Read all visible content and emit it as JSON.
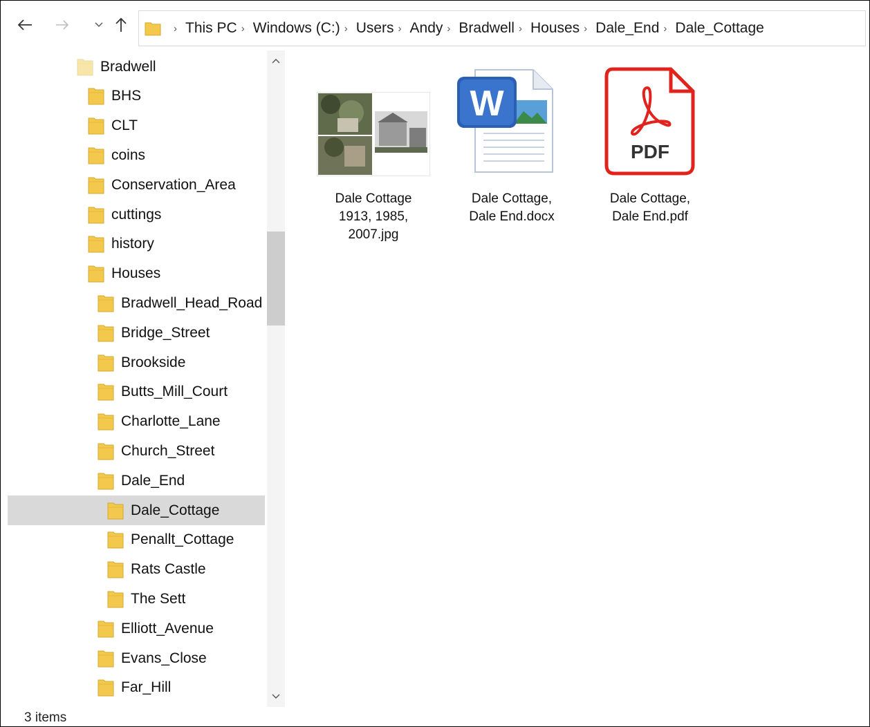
{
  "breadcrumb": [
    "This PC",
    "Windows (C:)",
    "Users",
    "Andy",
    "Bradwell",
    "Houses",
    "Dale_End",
    "Dale_Cottage"
  ],
  "icons": {
    "back": "arrow-left-icon",
    "forward": "arrow-right-icon",
    "recent": "chevron-down-icon",
    "up": "arrow-up-icon",
    "folder": "folder-icon"
  },
  "colors": {
    "folder": "#f2c94c",
    "folder_light": "#f8e6a8",
    "selected_bg": "#d9d9d9",
    "pdf_red": "#e1231e",
    "word_blue": "#2b5fb4"
  },
  "tree": [
    {
      "label": "Bradwell",
      "level": 0
    },
    {
      "label": "BHS",
      "level": 1
    },
    {
      "label": "CLT",
      "level": 1
    },
    {
      "label": "coins",
      "level": 1
    },
    {
      "label": "Conservation_Area",
      "level": 1
    },
    {
      "label": "cuttings",
      "level": 1
    },
    {
      "label": "history",
      "level": 1
    },
    {
      "label": "Houses",
      "level": 1
    },
    {
      "label": "Bradwell_Head_Road",
      "level": 2
    },
    {
      "label": "Bridge_Street",
      "level": 2
    },
    {
      "label": "Brookside",
      "level": 2
    },
    {
      "label": "Butts_Mill_Court",
      "level": 2
    },
    {
      "label": "Charlotte_Lane",
      "level": 2
    },
    {
      "label": "Church_Street",
      "level": 2
    },
    {
      "label": "Dale_End",
      "level": 2
    },
    {
      "label": "Dale_Cottage",
      "level": 3,
      "selected": true
    },
    {
      "label": "Penallt_Cottage",
      "level": 3
    },
    {
      "label": "Rats Castle",
      "level": 3
    },
    {
      "label": "The Sett",
      "level": 3
    },
    {
      "label": "Elliott_Avenue",
      "level": 2
    },
    {
      "label": "Evans_Close",
      "level": 2
    },
    {
      "label": "Far_Hill",
      "level": 2
    }
  ],
  "files": [
    {
      "type": "image",
      "icon": "image-thumbnail-icon",
      "lines": [
        "Dale Cottage",
        "1913, 1985,",
        "2007.jpg"
      ]
    },
    {
      "type": "docx",
      "icon": "word-document-icon",
      "lines": [
        "Dale Cottage,",
        "Dale End.docx"
      ]
    },
    {
      "type": "pdf",
      "icon": "pdf-document-icon",
      "badge": "PDF",
      "lines": [
        "Dale Cottage,",
        "Dale End.pdf"
      ]
    }
  ],
  "status": {
    "items": "3 items"
  }
}
